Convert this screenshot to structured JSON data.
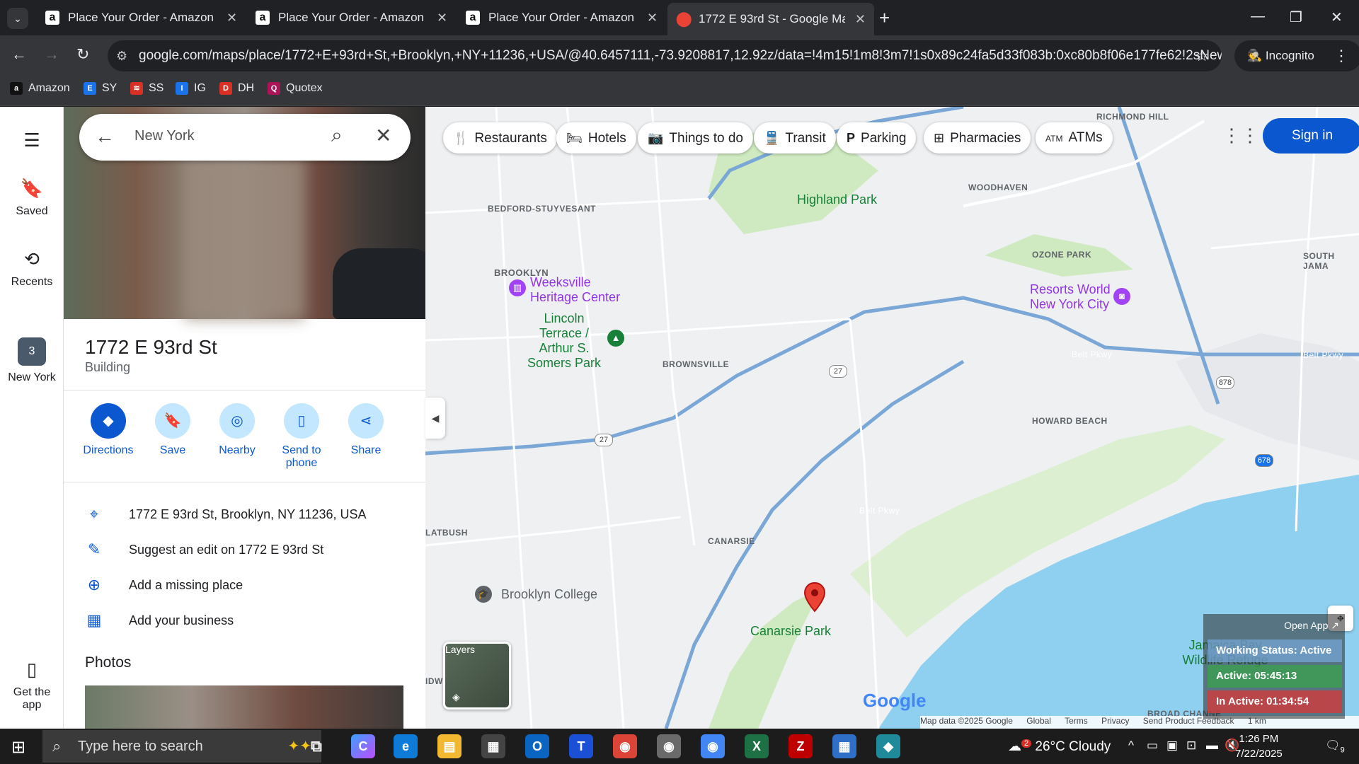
{
  "browser": {
    "tabs": [
      {
        "title": "Place Your Order - Amazon Che",
        "icon": "amazon-icon",
        "active": false
      },
      {
        "title": "Place Your Order - Amazon Che",
        "icon": "amazon-icon",
        "active": false
      },
      {
        "title": "Place Your Order - Amazon Che",
        "icon": "amazon-icon",
        "active": false
      },
      {
        "title": "1772 E 93rd St - Google Maps",
        "icon": "google-maps-icon",
        "active": true
      }
    ],
    "url": "google.com/maps/place/1772+E+93rd+St,+Brooklyn,+NY+11236,+USA/@40.6457111,-73.9208817,12.92z/data=!4m15!1m8!3m7!1s0x89c24fa5d33f083b:0xc80b8f06e177fe62!2sNew+York,+...",
    "incognito_label": "Incognito",
    "bookmarks": [
      {
        "label": "Amazon",
        "color": "#111111"
      },
      {
        "label": "SY",
        "color": "#1a73e8"
      },
      {
        "label": "SS",
        "color": "#d93025"
      },
      {
        "label": "IG",
        "color": "#1a73e8"
      },
      {
        "label": "DH",
        "color": "#d93025"
      },
      {
        "label": "Quotex",
        "color": "#ad1457"
      }
    ]
  },
  "rail": {
    "saved": "Saved",
    "recents": "Recents",
    "new_york": "New York",
    "recent_count": "3",
    "get_app": "Get the app"
  },
  "search": {
    "query": "New York"
  },
  "place": {
    "title": "1772 E 93rd St",
    "type": "Building",
    "actions": [
      "Directions",
      "Save",
      "Nearby",
      "Send to phone",
      "Share"
    ],
    "address": "1772 E 93rd St, Brooklyn, NY 11236, USA",
    "suggest_edit": "Suggest an edit on 1772 E 93rd St",
    "add_place": "Add a missing place",
    "add_business": "Add your business",
    "photos_heading": "Photos"
  },
  "map": {
    "chips": [
      "Restaurants",
      "Hotels",
      "Things to do",
      "Transit",
      "Parking",
      "Pharmacies",
      "ATMs"
    ],
    "sign_in": "Sign in",
    "labels": {
      "bedford": "BEDFORD-STUYVESANT",
      "brooklyn": "BROOKLYN",
      "brownsville": "BROWNSVILLE",
      "canarsie": "CANARSIE",
      "flatbush": "LATBUSH",
      "woodhaven": "WOODHAVEN",
      "ozone": "OZONE PARK",
      "richmond": "RICHMOND HILL",
      "south_jamaica": "SOUTH JAMA",
      "howard": "HOWARD BEACH",
      "broad_channel": "BROAD CHANNE",
      "idw": "IDW"
    },
    "places": {
      "highland": "Highland Park",
      "weeksville": "Weeksville Heritage Center",
      "lincoln": "Lincoln Terrace / Arthur S. Somers Park",
      "resorts": "Resorts World New York City",
      "brooklyn_college": "Brooklyn College",
      "canarsie_park": "Canarsie Park",
      "jamaica_bay": "Jamaica Bay Wildlife Refuge",
      "belt1": "Belt Pkwy",
      "belt2": "Belt Pkwy",
      "belt3": "Belt Pkwy"
    },
    "shields": [
      "27",
      "27",
      "878",
      "678"
    ],
    "layers": "Layers",
    "google": "Google",
    "footer": [
      "Map data ©2025 Google",
      "Global",
      "Terms",
      "Privacy",
      "Send Product Feedback",
      "1 km"
    ],
    "overlay": {
      "open_app": "Open App ↗",
      "status": "Working Status: Active",
      "active": "Active: 05:45:13",
      "inactive": "In Active: 01:34:54"
    }
  },
  "taskbar": {
    "search_placeholder": "Type here to search",
    "weather": "26°C  Cloudy",
    "weather_badge": "2",
    "time": "1:26 PM",
    "date": "7/22/2025",
    "notif_count": "9"
  }
}
